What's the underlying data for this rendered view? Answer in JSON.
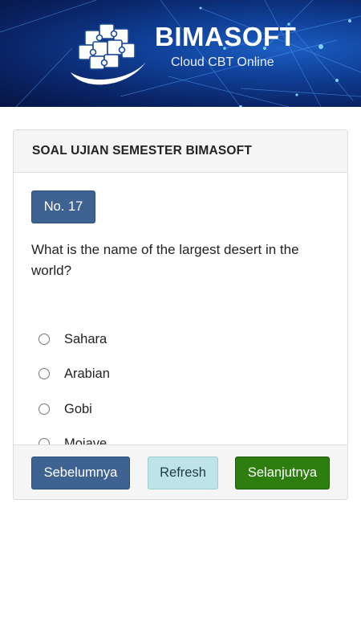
{
  "header": {
    "brand_title": "BIMASOFT",
    "brand_subtitle": "Cloud CBT Online",
    "logo_icon": "puzzle-globe-icon",
    "colors": {
      "banner_dark": "#061543",
      "banner_light": "#1d5fc4"
    }
  },
  "exam": {
    "title": "SOAL UJIAN SEMESTER BIMASOFT",
    "question_number": "No. 17",
    "question_text": "What is the name of the largest desert in the world?",
    "options": [
      {
        "label": "Sahara",
        "selected": false
      },
      {
        "label": "Arabian",
        "selected": false
      },
      {
        "label": "Gobi",
        "selected": false
      },
      {
        "label": "Mojave",
        "selected": false
      }
    ]
  },
  "footer": {
    "prev_label": "Sebelumnya",
    "refresh_label": "Refresh",
    "next_label": "Selanjutnya",
    "colors": {
      "prev": "#3e6393",
      "refresh": "#bfe4e8",
      "next": "#2e7d0f"
    }
  }
}
